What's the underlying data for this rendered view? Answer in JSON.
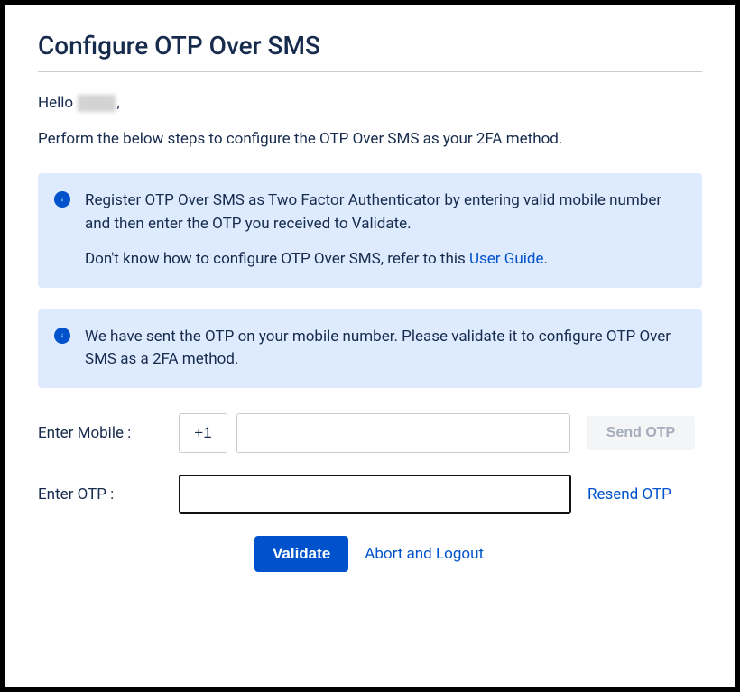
{
  "header": {
    "title": "Configure OTP Over SMS"
  },
  "greeting": {
    "prefix": "Hello ",
    "suffix": ","
  },
  "instruction": "Perform the below steps to configure the OTP Over SMS as your 2FA method.",
  "alert1": {
    "paragraph1": "Register OTP Over SMS as Two Factor Authenticator by entering valid mobile number and then enter the OTP you received to Validate.",
    "paragraph2_prefix": "Don't know how to configure OTP Over SMS, refer to this ",
    "paragraph2_link": "User Guide",
    "paragraph2_suffix": "."
  },
  "alert2": {
    "text": "We have sent the OTP on your mobile number. Please validate it to configure OTP Over SMS as a 2FA method."
  },
  "form": {
    "mobile_label": "Enter Mobile :",
    "otp_label": "Enter OTP :",
    "country_code": "+1",
    "mobile_value": "",
    "mobile_placeholder": " ",
    "otp_value": "",
    "send_otp_label": "Send OTP",
    "resend_otp_label": "Resend OTP"
  },
  "actions": {
    "validate_label": "Validate",
    "abort_label": "Abort and Logout"
  }
}
